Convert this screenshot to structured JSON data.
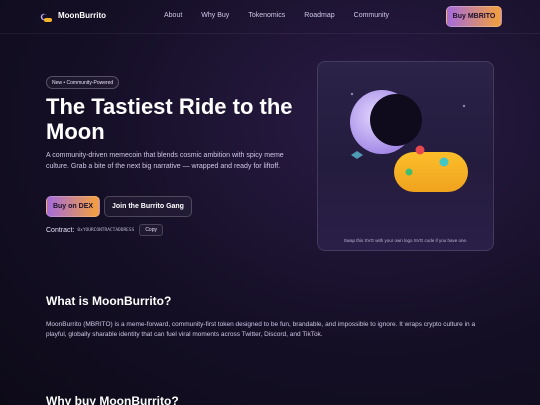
{
  "nav": {
    "brand": "MoonBurrito",
    "links": [
      "About",
      "Why Buy",
      "Tokenomics",
      "Roadmap",
      "Community"
    ],
    "cta": "Buy MBRITO"
  },
  "hero": {
    "badge": "New • Community-Powered",
    "title": "The Tastiest Ride to the Moon",
    "subtitle": "A community-driven memecoin that blends cosmic ambition with spicy meme culture. Grab a bite of the next big narrative — wrapped and ready for liftoff.",
    "buy_button": "Buy on DEX",
    "gang_button": "Join the Burrito Gang",
    "contract_label": "Contract:",
    "contract_address": "0xYOURCONTRACTADDRESS",
    "copy_button": "Copy"
  },
  "art": {
    "caption": "Swap this SVG with your own logo SVG code if you have one."
  },
  "about": {
    "title": "What is MoonBurrito?",
    "text": "MoonBurrito (MBRITO) is a meme-forward, community-first token designed to be fun, brandable, and impossible to ignore. It wraps crypto culture in a playful, globally sharable identity that can fuel viral moments across Twitter, Discord, and TikTok."
  },
  "why": {
    "title": "Why buy MoonBurrito?"
  },
  "colors": {
    "accent_start": "#a46bdc",
    "accent_end": "#f5a13a",
    "background": "#150f26",
    "burrito": "#f7b52a",
    "moon": "#c6b3ff"
  }
}
